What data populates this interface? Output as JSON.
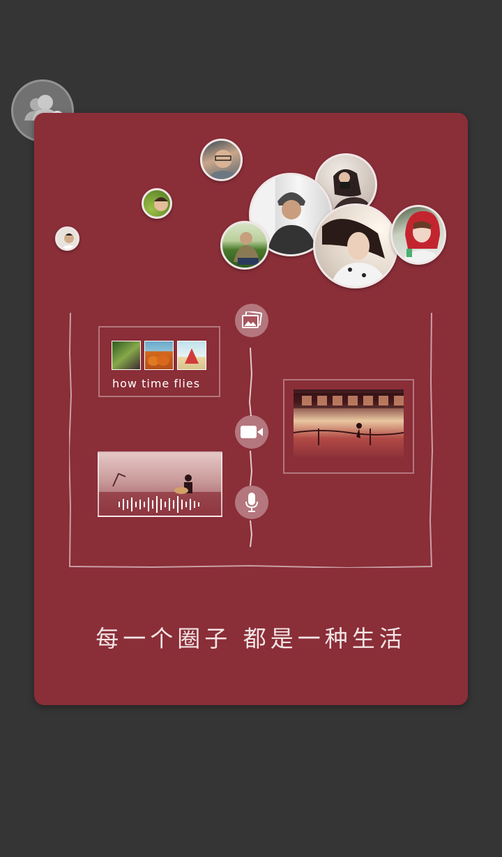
{
  "theme": {
    "background": "#353535",
    "card": "#8a2e38",
    "accent": "#ffffff"
  },
  "corner_badge": {
    "icon": "group-chat-icon"
  },
  "avatars": [
    {
      "name": "avatar-man-glasses"
    },
    {
      "name": "avatar-green-child"
    },
    {
      "name": "avatar-small-man"
    },
    {
      "name": "avatar-woman-camera"
    },
    {
      "name": "avatar-man-beanie"
    },
    {
      "name": "avatar-man-grass"
    },
    {
      "name": "avatar-woman-headphones"
    },
    {
      "name": "avatar-woman-red-scarf"
    }
  ],
  "media": {
    "photo_icon": "photo-album-icon",
    "video_icon": "video-camera-icon",
    "audio_icon": "microphone-icon",
    "photo_caption": "how time flies"
  },
  "tagline": "每一个圈子 都是一种生活"
}
